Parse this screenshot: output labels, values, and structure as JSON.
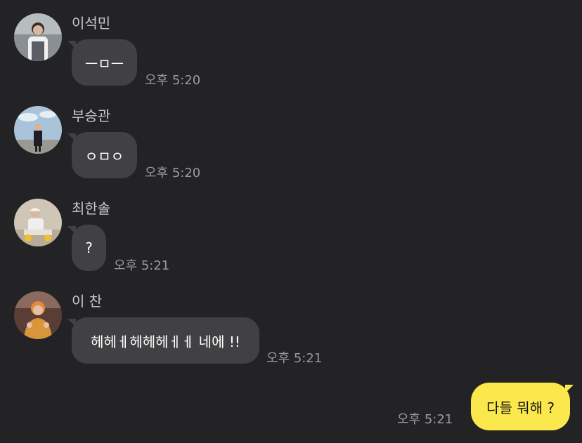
{
  "messages": [
    {
      "sender": "이석민",
      "text": "ㅡㅁㅡ",
      "time": "오후 5:20",
      "avatar": "avatar-photo"
    },
    {
      "sender": "부승관",
      "text": "ㅇㅁㅇ",
      "time": "오후 5:20",
      "avatar": "avatar-photo"
    },
    {
      "sender": "최한솔",
      "text": "?",
      "time": "오후 5:21",
      "avatar": "avatar-photo"
    },
    {
      "sender": "이 찬",
      "text": "헤헤ㅔ헤헤헤ㅔㅔ 네에 !!",
      "time": "오후 5:21",
      "avatar": "avatar-photo"
    }
  ],
  "my_message": {
    "text": "다들 뭐해 ?",
    "time": "오후 5:21"
  },
  "colors": {
    "background": "#232325",
    "incoming_bubble": "#414143",
    "outgoing_bubble": "#fae84c",
    "name_text": "#c9c9cb",
    "time_text": "#9a9a9c"
  }
}
